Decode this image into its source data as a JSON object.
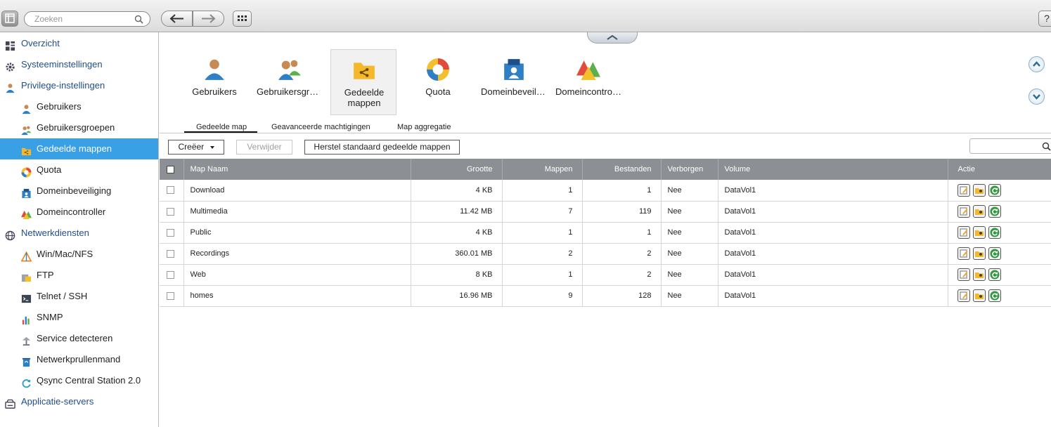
{
  "topbar": {
    "search_placeholder": "Zoeken",
    "help_label": "?"
  },
  "sidebar": {
    "items": [
      {
        "label": "Overzicht",
        "kind": "cat",
        "icon": "grid-icon"
      },
      {
        "label": "Systeeminstellingen",
        "kind": "cat",
        "icon": "gear-icon"
      },
      {
        "label": "Privilege-instellingen",
        "kind": "cat",
        "icon": "user-icon"
      },
      {
        "label": "Gebruikers",
        "kind": "sub",
        "icon": "user-icon"
      },
      {
        "label": "Gebruikersgroepen",
        "kind": "sub",
        "icon": "users-icon"
      },
      {
        "label": "Gedeelde mappen",
        "kind": "sub",
        "icon": "shared-folder-icon",
        "selected": true
      },
      {
        "label": "Quota",
        "kind": "sub",
        "icon": "quota-icon"
      },
      {
        "label": "Domeinbeveiliging",
        "kind": "sub",
        "icon": "domain-security-icon"
      },
      {
        "label": "Domeincontroller",
        "kind": "sub",
        "icon": "domain-controller-icon"
      },
      {
        "label": "Netwerkdiensten",
        "kind": "cat",
        "icon": "globe-icon"
      },
      {
        "label": "Win/Mac/NFS",
        "kind": "sub",
        "icon": "triangle-icon"
      },
      {
        "label": "FTP",
        "kind": "sub",
        "icon": "ftp-icon"
      },
      {
        "label": "Telnet / SSH",
        "kind": "sub",
        "icon": "terminal-icon"
      },
      {
        "label": "SNMP",
        "kind": "sub",
        "icon": "bar-chart-icon"
      },
      {
        "label": "Service detecteren",
        "kind": "sub",
        "icon": "discovery-icon"
      },
      {
        "label": "Netwerkprullenmand",
        "kind": "sub",
        "icon": "recycle-bin-icon"
      },
      {
        "label": "Qsync Central Station 2.0",
        "kind": "sub",
        "icon": "sync-icon"
      },
      {
        "label": "Applicatie-servers",
        "kind": "cat",
        "icon": "server-icon"
      }
    ]
  },
  "apps": [
    {
      "label": "Gebruikers",
      "icon": "user-icon"
    },
    {
      "label": "Gebruikersgroe...",
      "icon": "users-icon"
    },
    {
      "label1": "Gedeelde",
      "label2": "mappen",
      "icon": "shared-folder-icon",
      "selected": true
    },
    {
      "label": "Quota",
      "icon": "quota-icon"
    },
    {
      "label": "Domeinbeveilig...",
      "icon": "domain-security-icon"
    },
    {
      "label": "Domeincontroll...",
      "icon": "domain-controller-icon"
    }
  ],
  "tabs": [
    "Gedeelde map",
    "Geavanceerde machtigingen",
    "Map aggregatie"
  ],
  "toolbar": {
    "create_label": "Creëer",
    "delete_label": "Verwijder",
    "restore_label": "Herstel standaard gedeelde mappen"
  },
  "table": {
    "headers": [
      "Map Naam",
      "Grootte",
      "Mappen",
      "Bestanden",
      "Verborgen",
      "Volume",
      "Actie"
    ],
    "rows": [
      {
        "name": "Download",
        "size": "4 KB",
        "folders": "1",
        "files": "1",
        "hidden": "Nee",
        "volume": "DataVol1"
      },
      {
        "name": "Multimedia",
        "size": "11.42 MB",
        "folders": "7",
        "files": "119",
        "hidden": "Nee",
        "volume": "DataVol1"
      },
      {
        "name": "Public",
        "size": "4 KB",
        "folders": "1",
        "files": "1",
        "hidden": "Nee",
        "volume": "DataVol1"
      },
      {
        "name": "Recordings",
        "size": "360.01 MB",
        "folders": "2",
        "files": "2",
        "hidden": "Nee",
        "volume": "DataVol1"
      },
      {
        "name": "Web",
        "size": "8 KB",
        "folders": "1",
        "files": "2",
        "hidden": "Nee",
        "volume": "DataVol1"
      },
      {
        "name": "homes",
        "size": "16.96 MB",
        "folders": "9",
        "files": "128",
        "hidden": "Nee",
        "volume": "DataVol1"
      }
    ]
  },
  "colors": {
    "accent": "#3aa0e6",
    "header_bg": "#8c8f94",
    "category_text": "#1f4e8a"
  }
}
